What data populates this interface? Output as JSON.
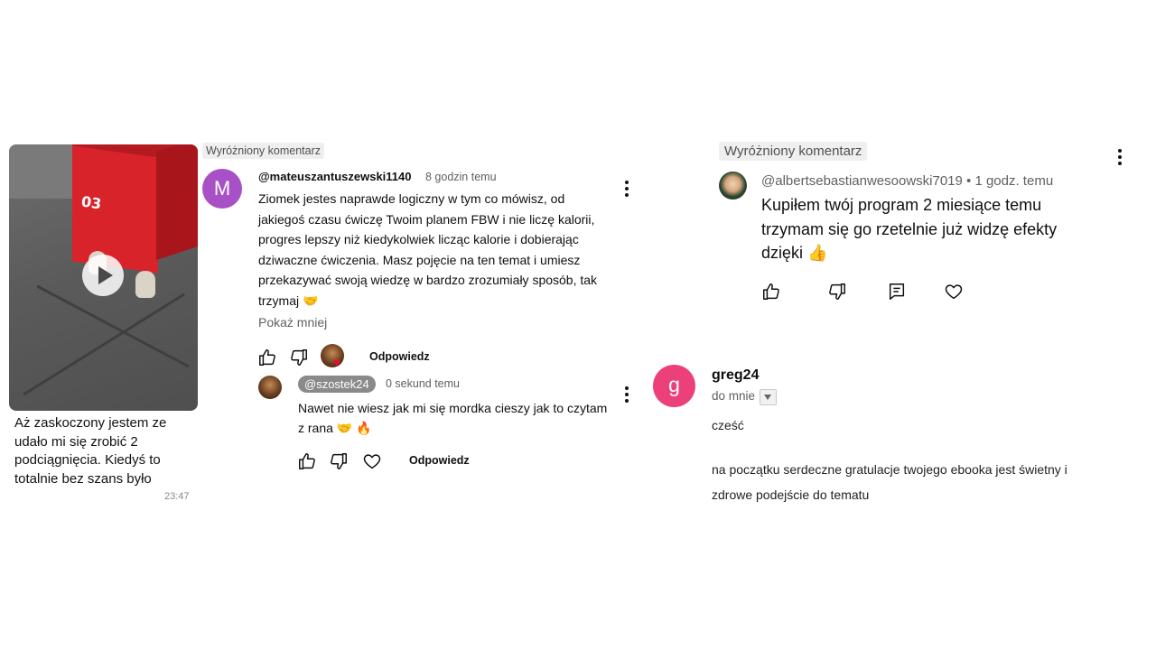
{
  "chat_message": {
    "text": "Aż zaskoczony jestem ze udało mi się zrobić 2 podciągnięcia. Kiedyś to totalnie bez szans było",
    "time": "23:47",
    "video_box_label": "03"
  },
  "comment_left": {
    "badge": "Wyróżniony komentarz",
    "avatar_letter": "M",
    "avatar_color": "#a851c6",
    "username": "@mateuszantuszewski1140",
    "time": "8 godzin temu",
    "body": "Ziomek jestes naprawde logiczny w tym co mówisz, od jakiegoś czasu ćwiczę Twoim planem FBW i nie liczę kalorii, progres lepszy niż kiedykolwiek licząc kalorie i dobierając dziwaczne ćwiczenia. Masz pojęcie na ten temat i umiesz przekazywać swoją wiedzę w bardzo zrozumiały sposób, tak trzymaj 🤝",
    "show_less": "Pokaż mniej",
    "reply_label": "Odpowiedz",
    "reply": {
      "username": "@szostek24",
      "time": "0 sekund temu",
      "body": "Nawet nie wiesz jak mi się mordka cieszy jak to czytam z rana 🤝 🔥",
      "reply_label": "Odpowiedz"
    }
  },
  "comment_right": {
    "badge": "Wyróżniony komentarz",
    "username": "@albertsebastianwesoowski7019",
    "time": "1 godz. temu",
    "meta": "@albertsebastianwesoowski7019 • 1 godz. temu",
    "body": "Kupiłem twój program 2 miesiące temu trzymam się go rzetelnie już widzę efekty dzięki 👍"
  },
  "email": {
    "avatar_letter": "g",
    "avatar_color": "#ec407a",
    "sender": "greg24",
    "to": "do mnie",
    "greeting": "cześć",
    "body": "na początku serdeczne gratulacje twojego ebooka jest świetny i zdrowe podejście do tematu"
  },
  "colors": {
    "like_heart": "#ff0033",
    "muted_text": "#606060",
    "badge_bg": "#efefef"
  }
}
